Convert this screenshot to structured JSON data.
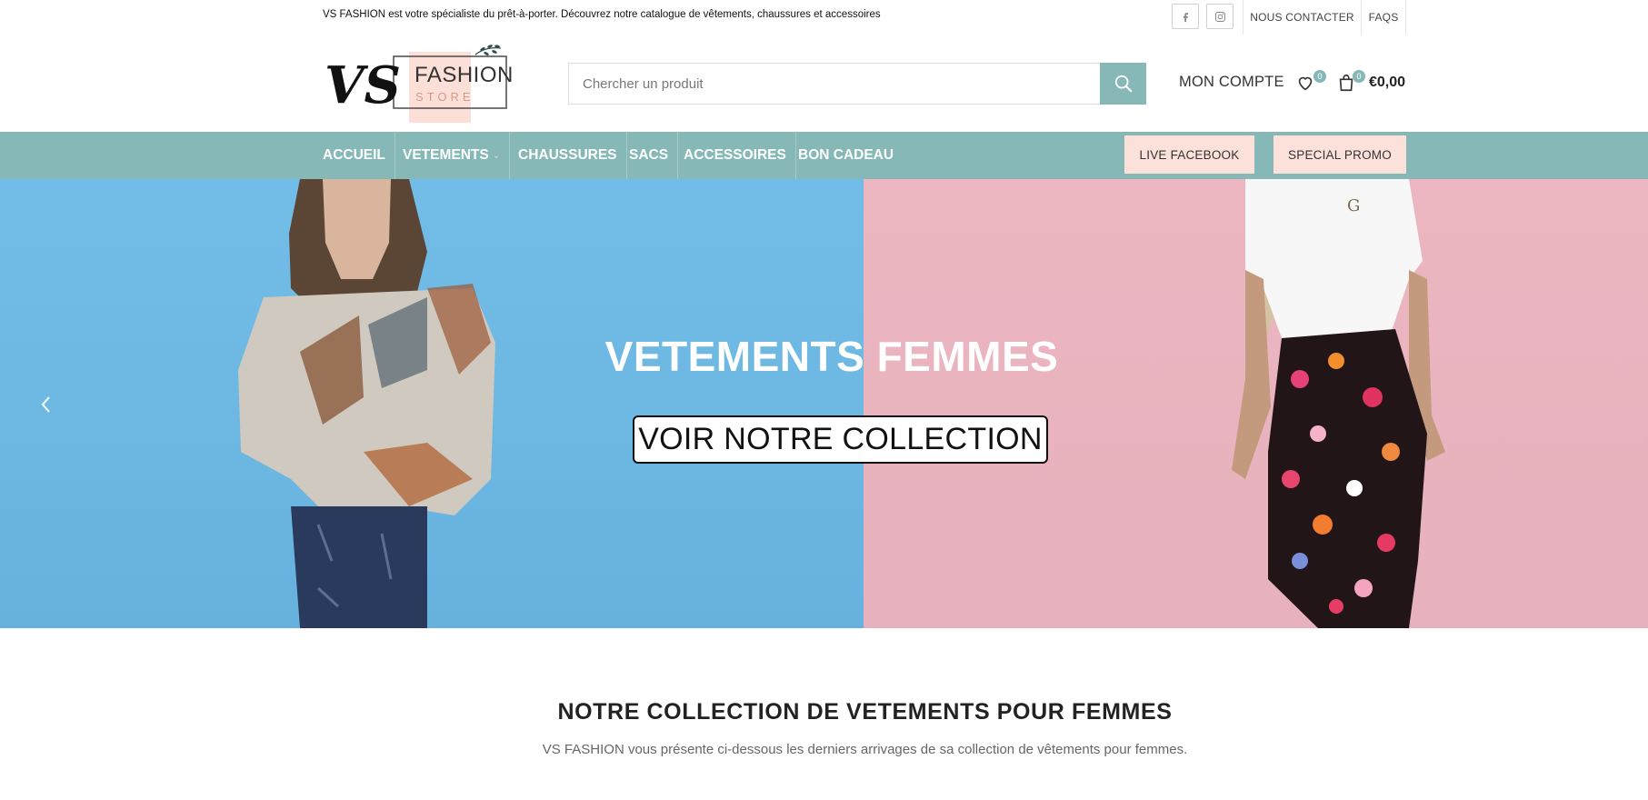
{
  "topbar": {
    "tagline": "VS FASHION est votre spécialiste du prêt-à-porter. Découvrez notre catalogue de vêtements, chaussures et accessoires",
    "social": [
      {
        "name": "facebook-icon"
      },
      {
        "name": "instagram-icon"
      }
    ],
    "links": {
      "contact": "NOUS CONTACTER",
      "faqs": "FAQS"
    }
  },
  "header": {
    "logo": {
      "mark": "VS",
      "line1": "FASHION",
      "line2": "STORE"
    },
    "search": {
      "placeholder": "Chercher un produit"
    },
    "account": "MON COMPTE",
    "wishlist_count": "0",
    "cart_count": "0",
    "cart_total": "€0,00"
  },
  "nav": {
    "items": [
      {
        "label": "ACCUEIL"
      },
      {
        "label": "VETEMENTS"
      },
      {
        "label": "CHAUSSURES"
      },
      {
        "label": "SACS"
      },
      {
        "label": "ACCESSOIRES"
      },
      {
        "label": "BON CADEAU"
      }
    ],
    "buttons": {
      "live": "LIVE FACEBOOK",
      "promo": "SPECIAL PROMO"
    }
  },
  "hero": {
    "title": "VETEMENTS FEMMES",
    "cta": "VOIR NOTRE COLLECTION",
    "colors": {
      "left": "#6db7e3",
      "right": "#e8b3bf"
    }
  },
  "section": {
    "title": "NOTRE COLLECTION DE VETEMENTS POUR FEMMES",
    "subtitle": "VS FASHION vous présente ci-dessous les derniers arrivages de sa collection de vêtements pour femmes."
  },
  "colors": {
    "accent": "#87b8b8",
    "nav_button_bg": "#fbe1d9"
  }
}
